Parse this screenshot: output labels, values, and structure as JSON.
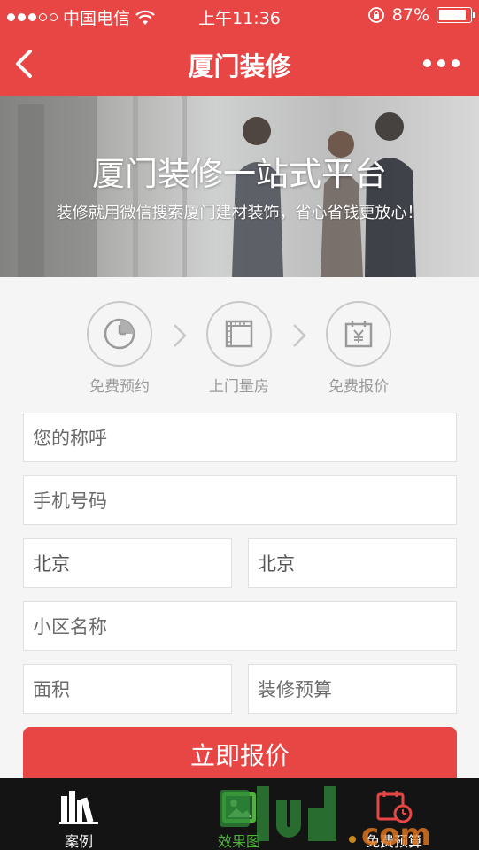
{
  "status_bar": {
    "carrier": "中国电信",
    "time": "上午11:36",
    "battery": "87%",
    "battery_level": 0.87
  },
  "nav": {
    "title": "厦门装修",
    "back_icon": "chevron-left-icon",
    "more_icon": "more-dots-icon"
  },
  "banner": {
    "title": "厦门装修一站式平台",
    "subtitle": "装修就用微信搜索厦门建材装饰，省心省钱更放心！"
  },
  "steps": [
    {
      "label": "免费预约",
      "icon": "clock-icon"
    },
    {
      "label": "上门量房",
      "icon": "ruler-icon"
    },
    {
      "label": "免费报价",
      "icon": "price-calendar-icon"
    }
  ],
  "form": {
    "name_placeholder": "您的称呼",
    "phone_placeholder": "手机号码",
    "province": "北京",
    "city": "北京",
    "community_placeholder": "小区名称",
    "area_placeholder": "面积",
    "budget_placeholder": "装修预算",
    "submit_label": "立即报价"
  },
  "tabs": [
    {
      "label": "案例",
      "icon": "books-icon"
    },
    {
      "label": "效果图",
      "icon": "picture-icon"
    },
    {
      "label": "免费预算",
      "icon": "calendar-clock-icon"
    }
  ],
  "colors": {
    "primary": "#e84545",
    "tab_bg": "#141414",
    "active_tab": "#4fb23a"
  }
}
